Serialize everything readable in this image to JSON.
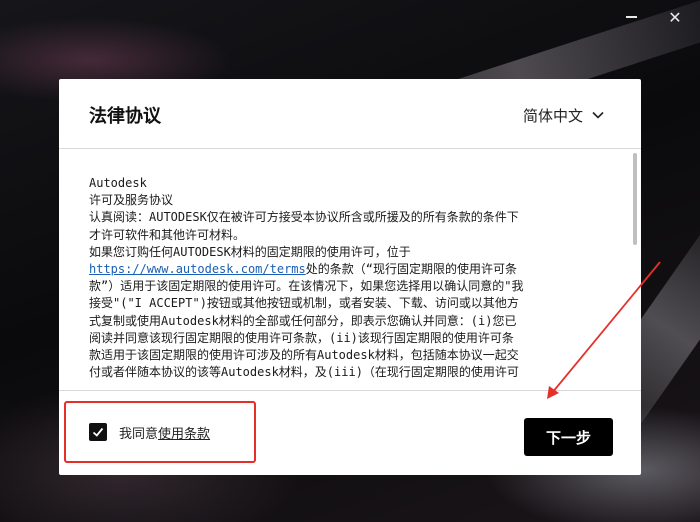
{
  "window": {
    "minimize_label": "",
    "close_label": "✕"
  },
  "dialog": {
    "title": "法律协议",
    "language": "简体中文",
    "agreement_lines": [
      "Autodesk",
      "许可及服务协议",
      "认真阅读：AUTODESK仅在被许可方接受本协议所含或所援及的所有条款的条件下",
      "才许可软件和其他许可材料。",
      "如果您订购任何AUTODESK材料的固定期限的使用许可，位于"
    ],
    "agreement_url": "https://www.autodesk.com/terms",
    "agreement_after_url": "处的条款（“现行固定期限的使用许可条",
    "agreement_lines_2": [
      "款”）适用于该固定期限的使用许可。在该情况下，如果您选择用以确认同意的\"我",
      "接受\"(\"I ACCEPT\")按钮或其他按钮或机制，或者安装、下载、访问或以其他方",
      "式复制或使用Autodesk材料的全部或任何部分，即表示您确认并同意：(i)您已",
      "阅读并同意该现行固定期限的使用许可条款，(ii)该现行固定期限的使用许可条",
      "款适用于该固定期限的使用许可涉及的所有Autodesk材料，包括随本协议一起交",
      "付或者伴随本协议的该等Autodesk材料，及(iii)（在现行固定期限的使用许可"
    ],
    "agree_prefix": "我同意",
    "agree_link": "使用条款",
    "agree_checked": true,
    "next_button": "下一步"
  },
  "annotations": {
    "highlight_color": "#e5302a",
    "arrow_color": "#e5302a"
  }
}
